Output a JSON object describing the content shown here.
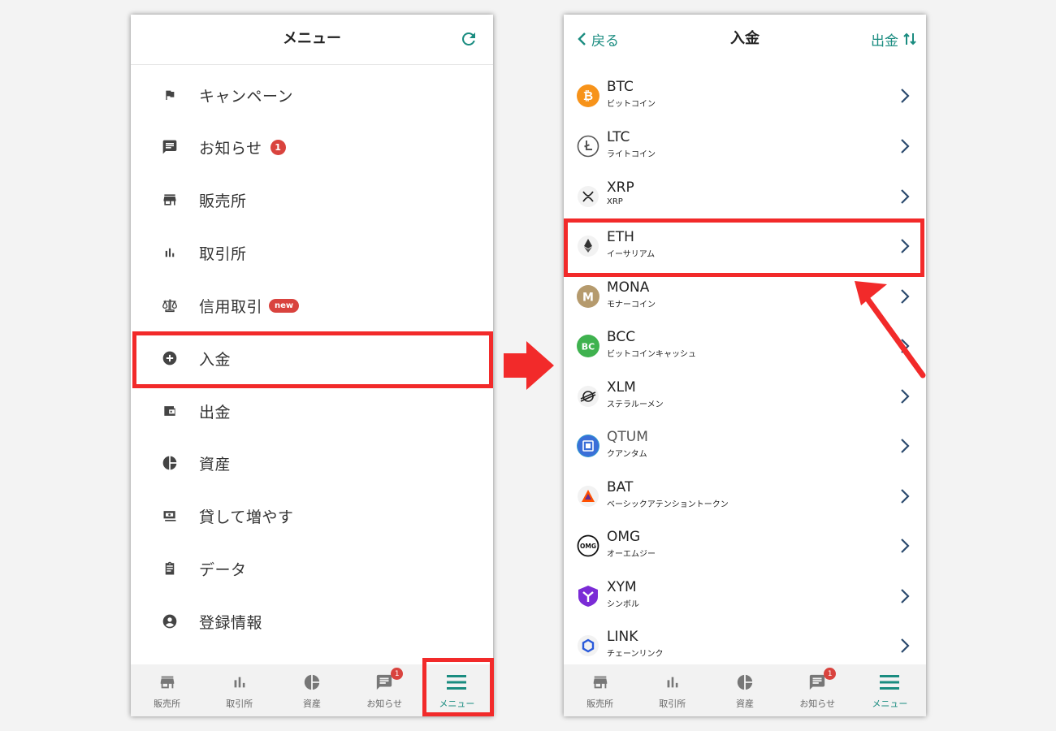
{
  "left": {
    "title": "メニュー",
    "menu": [
      {
        "label": "キャンペーン",
        "icon": "flag-icon"
      },
      {
        "label": "お知らせ",
        "icon": "message-icon",
        "badge": "1"
      },
      {
        "label": "販売所",
        "icon": "store-icon"
      },
      {
        "label": "取引所",
        "icon": "bar-chart-icon"
      },
      {
        "label": "信用取引",
        "icon": "scale-icon",
        "badge_new": "new"
      },
      {
        "label": "入金",
        "icon": "plus-circle-icon"
      },
      {
        "label": "出金",
        "icon": "wallet-icon"
      },
      {
        "label": "資産",
        "icon": "pie-chart-icon"
      },
      {
        "label": "貸して増やす",
        "icon": "cash-icon"
      },
      {
        "label": "データ",
        "icon": "clipboard-icon"
      },
      {
        "label": "登録情報",
        "icon": "account-icon"
      }
    ]
  },
  "right": {
    "back_label": "戻る",
    "title": "入金",
    "withdraw_label": "出金",
    "coins": [
      {
        "symbol": "BTC",
        "name": "ビットコイン",
        "color": "#f7931a"
      },
      {
        "symbol": "LTC",
        "name": "ライトコイン",
        "color": "#ffffff"
      },
      {
        "symbol": "XRP",
        "name": "XRP",
        "color": "#ffffff"
      },
      {
        "symbol": "ETH",
        "name": "イーサリアム",
        "color": "#ffffff"
      },
      {
        "symbol": "MONA",
        "name": "モナーコイン",
        "color": "#b59a6d"
      },
      {
        "symbol": "BCC",
        "name": "ビットコインキャッシュ",
        "color": "#3fb24f"
      },
      {
        "symbol": "XLM",
        "name": "ステラルーメン",
        "color": "#ffffff"
      },
      {
        "symbol": "QTUM",
        "name": "クアンタム",
        "color": "#2e9ad0"
      },
      {
        "symbol": "BAT",
        "name": "ベーシックアテンショントークン",
        "color": "#ffffff"
      },
      {
        "symbol": "OMG",
        "name": "オーエムジー",
        "color": "#ffffff"
      },
      {
        "symbol": "XYM",
        "name": "シンボル",
        "color": "#7b2bd6"
      },
      {
        "symbol": "LINK",
        "name": "チェーンリンク",
        "color": "#ffffff"
      }
    ]
  },
  "tabs": [
    {
      "label": "販売所",
      "icon": "store-icon"
    },
    {
      "label": "取引所",
      "icon": "bar-chart-icon"
    },
    {
      "label": "資産",
      "icon": "pie-chart-icon"
    },
    {
      "label": "お知らせ",
      "icon": "message-icon",
      "badge": "1"
    },
    {
      "label": "メニュー",
      "icon": "menu-icon"
    }
  ],
  "colors": {
    "accent": "#1a8c80",
    "highlight": "#f22a2a",
    "badge": "#d9433e"
  }
}
